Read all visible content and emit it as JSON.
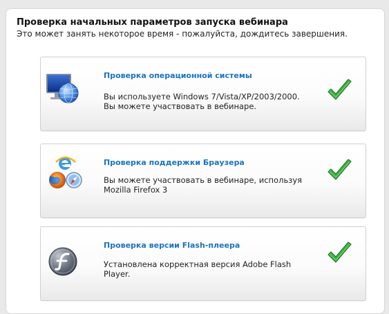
{
  "header": {
    "title": "Проверка начальных параметров запуска вебинара",
    "subtitle": "Это может занять некоторое время - пожалуйста, дождитесь завершения."
  },
  "checks": [
    {
      "title": "Проверка операционной системы",
      "lines": [
        "Вы используете Windows 7/Vista/XP/2003/2000.",
        "Вы можете участвовать в вебинаре."
      ],
      "icon": "monitor-globe-icon",
      "status": "passed"
    },
    {
      "title": "Проверка поддержки Браузера",
      "lines": [
        "Вы можете участвовать в вебинаре, используя",
        "Mozilla Firefox 3"
      ],
      "icon": "browsers-icon",
      "status": "passed"
    },
    {
      "title": "Проверка версии Flash-плеера",
      "lines": [
        "Установлена корректная версия Adobe Flash",
        "Player."
      ],
      "icon": "flash-player-icon",
      "status": "passed"
    }
  ],
  "colors": {
    "link_blue": "#1b72c0",
    "check_green": "#3cb043",
    "background": "#e9e9e9"
  }
}
